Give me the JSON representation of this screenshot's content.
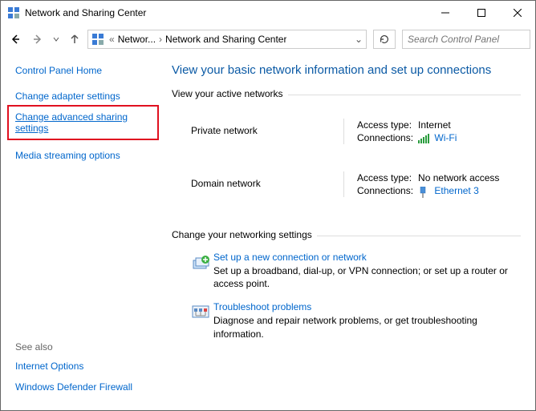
{
  "window": {
    "title": "Network and Sharing Center"
  },
  "breadcrumb": {
    "seg1": "Networ...",
    "seg2": "Network and Sharing Center"
  },
  "search": {
    "placeholder": "Search Control Panel"
  },
  "sidebar": {
    "cphome": "Control Panel Home",
    "links": {
      "adapter": "Change adapter settings",
      "advanced": "Change advanced sharing settings",
      "media": "Media streaming options"
    },
    "seealso_hdr": "See also",
    "seealso": {
      "internet_options": "Internet Options",
      "firewall": "Windows Defender Firewall"
    }
  },
  "main": {
    "heading": "View your basic network information and set up connections",
    "active_networks_label": "View your active networks",
    "networking_settings_label": "Change your networking settings",
    "labels": {
      "access_type": "Access type:",
      "connections": "Connections:"
    },
    "networks": [
      {
        "name": "Private network",
        "access": "Internet",
        "conn_label": "Wi-Fi",
        "conn_icon": "wifi"
      },
      {
        "name": "Domain network",
        "access": "No network access",
        "conn_label": "Ethernet 3",
        "conn_icon": "ethernet"
      }
    ],
    "settings": [
      {
        "title": "Set up a new connection or network",
        "desc": "Set up a broadband, dial-up, or VPN connection; or set up a router or access point."
      },
      {
        "title": "Troubleshoot problems",
        "desc": "Diagnose and repair network problems, or get troubleshooting information."
      }
    ]
  }
}
